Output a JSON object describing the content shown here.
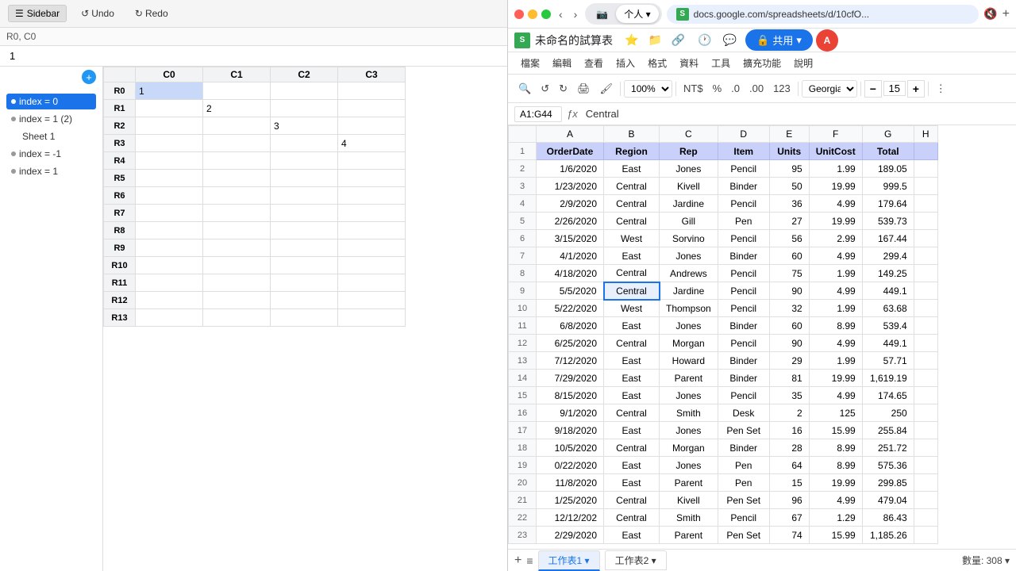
{
  "leftPanel": {
    "toolbar": {
      "sidebar_label": "Sidebar",
      "undo_label": "Undo",
      "redo_label": "Redo"
    },
    "cellRef": "R0, C0",
    "formulaValue": "1",
    "addSheetBtn": "+",
    "tree": [
      {
        "id": "index0",
        "label": "index = 0",
        "indent": false,
        "active": true
      },
      {
        "id": "index1_2",
        "label": "index = 1 (2)",
        "indent": false,
        "active": false
      },
      {
        "id": "sheet1",
        "label": "Sheet 1",
        "indent": true,
        "active": false
      },
      {
        "id": "index_neg1",
        "label": "index = -1",
        "indent": false,
        "active": false
      },
      {
        "id": "index1",
        "label": "index = 1",
        "indent": false,
        "active": false
      }
    ],
    "colHeaders": [
      "C0",
      "C1",
      "C2",
      "C3"
    ],
    "rowHeaders": [
      "R0",
      "R1",
      "R2",
      "R3",
      "R4",
      "R5",
      "R6",
      "R7",
      "R8",
      "R9",
      "R10",
      "R11",
      "R12",
      "R13"
    ],
    "cells": {
      "R0_C0": "1",
      "R1_C1": "2",
      "R2_C2": "3",
      "R3_C3": "4"
    }
  },
  "rightPanel": {
    "tabs": [
      {
        "label": "📷",
        "active": false
      },
      {
        "label": "个人 ▾",
        "active": true
      }
    ],
    "navBtns": [
      "‹",
      "›",
      "⊞"
    ],
    "urlBar": {
      "favicon": "S",
      "text": "docs.google.com/spreadsheets/d/10cfO...",
      "muteIcon": "🔇"
    },
    "windowBtns": [
      "─",
      "□",
      "✕"
    ],
    "topBarIcons": [
      "🕐",
      "💬"
    ],
    "title": "未命名的試算表",
    "titleIcons": [
      "⭐",
      "📁",
      "🔗"
    ],
    "shareLabel": "共用",
    "menuItems": [
      "檔案",
      "編輯",
      "查看",
      "插入",
      "格式",
      "資料",
      "工具",
      "擴充功能",
      "說明"
    ],
    "toolbar": {
      "zoom": "100%",
      "currency": "NT$",
      "percent": "%",
      "decDecimals": ".0",
      "incDecimals": ".00",
      "moreFormats": "123",
      "font": "Georgia",
      "fontSizeMinus": "−",
      "fontSize": "15",
      "fontSizePlus": "+",
      "moreOptions": "⋮"
    },
    "formulaBar": {
      "cellName": "A1:G44",
      "fxLabel": "ƒx",
      "formula": "Central"
    },
    "columnHeaders": [
      "",
      "A",
      "B",
      "C",
      "D",
      "E",
      "F",
      "G",
      "H"
    ],
    "headerRow": {
      "row": 1,
      "cells": [
        "OrderDate",
        "Region",
        "Rep",
        "Item",
        "Units",
        "UnitCost",
        "Total"
      ]
    },
    "dataRows": [
      {
        "row": 2,
        "cells": [
          "1/6/2020",
          "East",
          "Jones",
          "Pencil",
          "95",
          "1.99",
          "189.05"
        ]
      },
      {
        "row": 3,
        "cells": [
          "1/23/2020",
          "Central",
          "Kivell",
          "Binder",
          "50",
          "19.99",
          "999.5"
        ]
      },
      {
        "row": 4,
        "cells": [
          "2/9/2020",
          "Central",
          "Jardine",
          "Pencil",
          "36",
          "4.99",
          "179.64"
        ]
      },
      {
        "row": 5,
        "cells": [
          "2/26/2020",
          "Central",
          "Gill",
          "Pen",
          "27",
          "19.99",
          "539.73"
        ]
      },
      {
        "row": 6,
        "cells": [
          "3/15/2020",
          "West",
          "Sorvino",
          "Pencil",
          "56",
          "2.99",
          "167.44"
        ]
      },
      {
        "row": 7,
        "cells": [
          "4/1/2020",
          "East",
          "Jones",
          "Binder",
          "60",
          "4.99",
          "299.4"
        ]
      },
      {
        "row": 8,
        "cells": [
          "4/18/2020",
          "Central",
          "Andrews",
          "Pencil",
          "75",
          "1.99",
          "149.25"
        ]
      },
      {
        "row": 9,
        "cells": [
          "5/5/2020",
          "Central",
          "Jardine",
          "Pencil",
          "90",
          "4.99",
          "449.1"
        ],
        "selectedB": true
      },
      {
        "row": 10,
        "cells": [
          "5/22/2020",
          "West",
          "Thompson",
          "Pencil",
          "32",
          "1.99",
          "63.68"
        ]
      },
      {
        "row": 11,
        "cells": [
          "6/8/2020",
          "East",
          "Jones",
          "Binder",
          "60",
          "8.99",
          "539.4"
        ]
      },
      {
        "row": 12,
        "cells": [
          "6/25/2020",
          "Central",
          "Morgan",
          "Pencil",
          "90",
          "4.99",
          "449.1"
        ]
      },
      {
        "row": 13,
        "cells": [
          "7/12/2020",
          "East",
          "Howard",
          "Binder",
          "29",
          "1.99",
          "57.71"
        ]
      },
      {
        "row": 14,
        "cells": [
          "7/29/2020",
          "East",
          "Parent",
          "Binder",
          "81",
          "19.99",
          "1,619.19"
        ]
      },
      {
        "row": 15,
        "cells": [
          "8/15/2020",
          "East",
          "Jones",
          "Pencil",
          "35",
          "4.99",
          "174.65"
        ]
      },
      {
        "row": 16,
        "cells": [
          "9/1/2020",
          "Central",
          "Smith",
          "Desk",
          "2",
          "125",
          "250"
        ]
      },
      {
        "row": 17,
        "cells": [
          "9/18/2020",
          "East",
          "Jones",
          "Pen Set",
          "16",
          "15.99",
          "255.84"
        ]
      },
      {
        "row": 18,
        "cells": [
          "10/5/2020",
          "Central",
          "Morgan",
          "Binder",
          "28",
          "8.99",
          "251.72"
        ]
      },
      {
        "row": 19,
        "cells": [
          "0/22/2020",
          "East",
          "Jones",
          "Pen",
          "64",
          "8.99",
          "575.36"
        ]
      },
      {
        "row": 20,
        "cells": [
          "11/8/2020",
          "East",
          "Parent",
          "Pen",
          "15",
          "19.99",
          "299.85"
        ]
      },
      {
        "row": 21,
        "cells": [
          "1/25/2020",
          "Central",
          "Kivell",
          "Pen Set",
          "96",
          "4.99",
          "479.04"
        ]
      },
      {
        "row": 22,
        "cells": [
          "12/12/202",
          "Central",
          "Smith",
          "Pencil",
          "67",
          "1.29",
          "86.43"
        ]
      },
      {
        "row": 23,
        "cells": [
          "2/29/2020",
          "East",
          "Parent",
          "Pen Set",
          "74",
          "15.99",
          "1,185.26"
        ]
      }
    ],
    "bottomBar": {
      "addBtn": "+",
      "menuBtn": "≡",
      "tab1": "工作表1",
      "tab2": "工作表2",
      "status": "數量: 308 ▾"
    }
  }
}
